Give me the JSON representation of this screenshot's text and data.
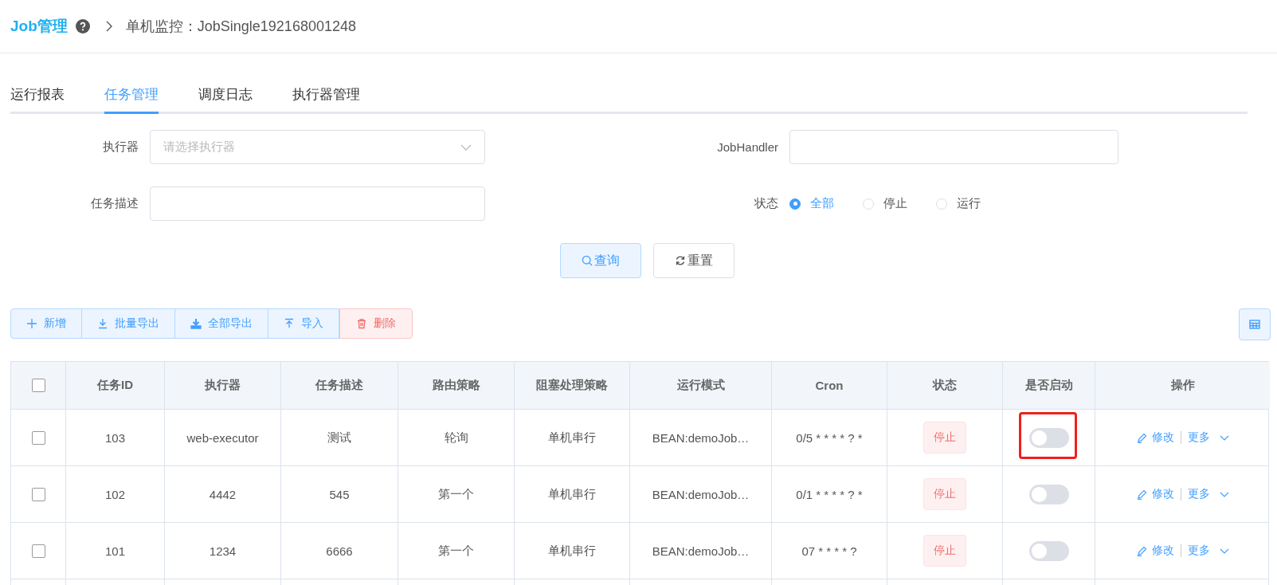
{
  "breadcrumb": {
    "title": "Job管理",
    "current": "单机监控：JobSingle192168001248"
  },
  "tabs": [
    {
      "label": "运行报表",
      "selected": false
    },
    {
      "label": "任务管理",
      "selected": true
    },
    {
      "label": "调度日志",
      "selected": false
    },
    {
      "label": "执行器管理",
      "selected": false
    }
  ],
  "filters": {
    "fields": [
      {
        "label": "执行器",
        "kind": "select",
        "placeholder": "请选择执行器"
      },
      {
        "label": "JobHandler",
        "kind": "input"
      },
      {
        "label": "任务描述",
        "kind": "input"
      }
    ],
    "status": {
      "label": "状态",
      "options": [
        {
          "label": "全部",
          "selected": true
        },
        {
          "label": "停止",
          "selected": false
        },
        {
          "label": "运行",
          "selected": false
        }
      ]
    }
  },
  "search_buttons": [
    {
      "label": "查询",
      "kind": "query"
    },
    {
      "label": "重置",
      "kind": "reset"
    }
  ],
  "toolbar": [
    {
      "label": "新增",
      "kind": "add"
    },
    {
      "label": "批量导出",
      "kind": "export"
    },
    {
      "label": "全部导出",
      "kind": "export-all"
    },
    {
      "label": "导入",
      "kind": "import"
    },
    {
      "label": "删除",
      "kind": "delete"
    }
  ],
  "table": {
    "select_all": {
      "checked": false
    },
    "columns": [
      "任务ID",
      "执行器",
      "任务描述",
      "路由策略",
      "阻塞处理策略",
      "运行模式",
      "Cron",
      "状态",
      "是否启动",
      "操作"
    ],
    "rows": [
      {
        "checked": false,
        "cells": [
          "103",
          "web-executor",
          "测试",
          "轮询",
          "单机串行",
          "BEAN:demoJob…",
          "0/5 * * * * ? *"
        ],
        "status": "停止",
        "enabled": false,
        "highlighted": true,
        "edit": "修改",
        "more": "更多"
      },
      {
        "checked": false,
        "cells": [
          "102",
          "4442",
          "545",
          "第一个",
          "单机串行",
          "BEAN:demoJob…",
          "0/1 * * * * ? *"
        ],
        "status": "停止",
        "enabled": false,
        "highlighted": false,
        "edit": "修改",
        "more": "更多"
      },
      {
        "checked": false,
        "cells": [
          "101",
          "1234",
          "6666",
          "第一个",
          "单机串行",
          "BEAN:demoJob…",
          "07 * * * * ?"
        ],
        "status": "停止",
        "enabled": false,
        "highlighted": false,
        "edit": "修改",
        "more": "更多"
      }
    ]
  }
}
